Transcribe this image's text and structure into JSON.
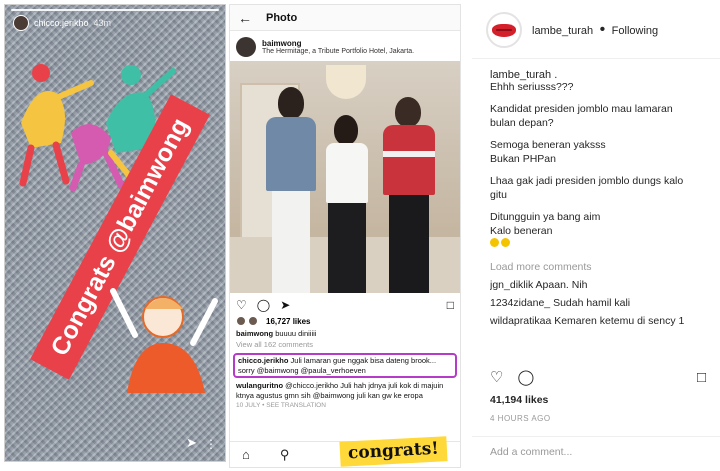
{
  "story": {
    "username": "chicco.jerikho",
    "time": "43m",
    "sticker_text": "Congrats @baimwong",
    "icons": [
      "send-icon",
      "more-icon"
    ]
  },
  "phone": {
    "title": "Photo",
    "post_user": "baimwong",
    "location": "The Hermitage, a Tribute Portfolio Hotel, Jakarta.",
    "likes": "16,727 likes",
    "caption_user": "baimwong",
    "caption_text": "buuuu diniiiii",
    "view_all": "View all 162 comments",
    "highlight_user": "chicco.jerikho",
    "highlight_text": "Juli lamaran gue nggak bisa dateng brook... sorry @baimwong @paula_verhoeven",
    "comment2_user": "wulanguritno",
    "comment2_text": "@chicco.jerikho Juli hah jdnya juli kok di majuin ktnya agustus gmn sih @baimwong juli kan gw ke eropa",
    "meta": "10 JULY • SEE TRANSLATION",
    "sticker": "congrats!"
  },
  "desk": {
    "username": "lambe_turah",
    "separator": "•",
    "follow_status": "Following",
    "caption_user": "lambe_turah .",
    "caption_lines": [
      "Ehhh seriusss???",
      "",
      "Kandidat presiden jomblo mau lamaran",
      "bulan depan?",
      "",
      "Semoga beneran yaksss",
      "Bukan PHPan",
      "",
      "Lhaa gak jadi presiden jomblo dungs kalo",
      "gitu",
      "",
      "Ditungguin ya bang aim",
      "Kalo beneran"
    ],
    "load_more": "Load more comments",
    "comments": [
      {
        "user": "jgn_diklik",
        "text": "Apaan. Nih"
      },
      {
        "user": "1234zidane_",
        "text": "Sudah hamil kali"
      },
      {
        "user": "wildapratikaa",
        "text": "Kemaren ketemu di sency 1"
      }
    ],
    "likes": "41,194 likes",
    "time": "4 HOURS AGO",
    "add_comment": "Add a comment..."
  }
}
